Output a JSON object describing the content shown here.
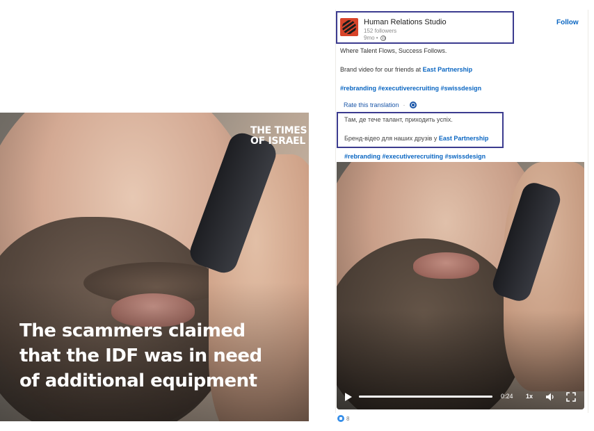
{
  "left_video": {
    "logo_line1": "THE TIMES",
    "logo_line2": "OF ISRAEL",
    "caption_lines": [
      "The scammers claimed",
      "that the IDF was in need",
      "of additional equipment"
    ]
  },
  "post": {
    "org_name": "Human Relations Studio",
    "followers": "152 followers",
    "time": "9mo •",
    "follow_label": "Follow",
    "tagline": "Where Talent Flows, Success Follows.",
    "brand_prefix": "Brand video for our friends at ",
    "brand_link": "East Partnership",
    "hashtags": "#rebranding #executiverecruiting #swissdesign",
    "rate_translation": "Rate this translation",
    "rate_dot": "·",
    "translated_tagline": "Там, де тече талант, приходить успіх.",
    "translated_brand_prefix": "Бренд-відео для наших друзів у ",
    "translated_brand_link": "East Partnership",
    "translated_hashtags": "#rebranding #executiverecruiting #swissdesign"
  },
  "video_player": {
    "time": "0:24",
    "speed": "1x",
    "progress": 1.0
  },
  "reactions": {
    "count": "8"
  }
}
